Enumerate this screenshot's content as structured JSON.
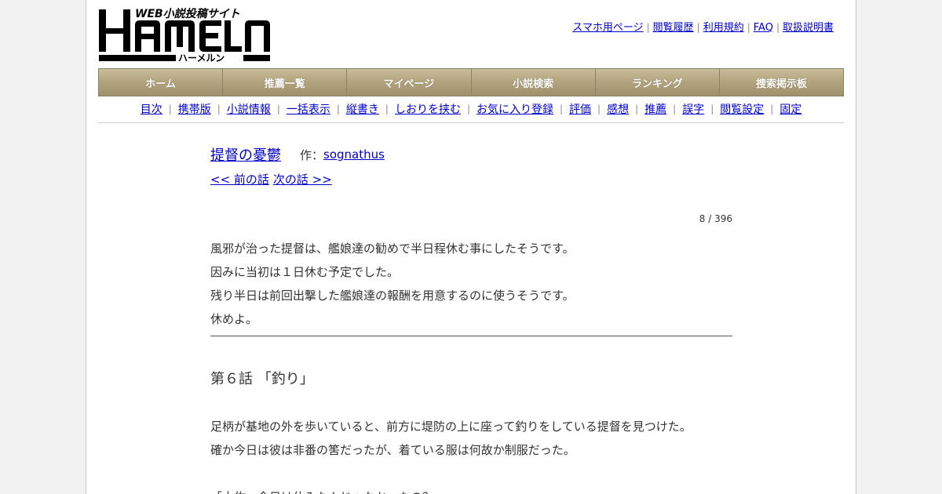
{
  "site": {
    "logo_text": "HAMELN",
    "logo_subtitle": "WEB小説投稿サイト",
    "logo_kana": "ハーメルン"
  },
  "top_links": [
    {
      "label": "スマホ用ページ"
    },
    {
      "label": "閲覧履歴"
    },
    {
      "label": "利用規約"
    },
    {
      "label": "FAQ"
    },
    {
      "label": "取扱説明書"
    }
  ],
  "top_sep": "|",
  "main_nav": [
    {
      "label": "ホーム"
    },
    {
      "label": "推薦一覧"
    },
    {
      "label": "マイページ"
    },
    {
      "label": "小説検索"
    },
    {
      "label": "ランキング"
    },
    {
      "label": "捜索掲示板"
    }
  ],
  "sub_nav": [
    {
      "label": "目次"
    },
    {
      "label": "携帯版"
    },
    {
      "label": "小説情報"
    },
    {
      "label": "一括表示"
    },
    {
      "label": "縦書き"
    },
    {
      "label": "しおりを挟む"
    },
    {
      "label": "お気に入り登録"
    },
    {
      "label": "評価"
    },
    {
      "label": "感想"
    },
    {
      "label": "推薦"
    },
    {
      "label": "誤字"
    },
    {
      "label": "閲覧設定"
    },
    {
      "label": "固定"
    }
  ],
  "novel": {
    "title": "提督の憂鬱",
    "author_label": "作：",
    "author": "sognathus",
    "prev": "<< 前の話",
    "next": "次の話 >>",
    "counter": "8 / 396"
  },
  "preface": [
    "風邪が治った提督は、艦娘達の勧めで半日程休む事にしたそうです。",
    "因みに当初は１日休む予定でした。",
    "残り半日は前回出撃した艦娘達の報酬を用意するのに使うそうです。",
    "休めよ。"
  ],
  "chapter_title": "第６話 「釣り」",
  "body_lines": [
    "足柄が基地の外を歩いていると、前方に堤防の上に座って釣りをしている提督を見つけた。",
    "確か今日は彼は非番の筈だったが、着ている服は何故か制服だった。",
    "",
    "「大佐、今日は休みなんじゃなかったの？」"
  ]
}
